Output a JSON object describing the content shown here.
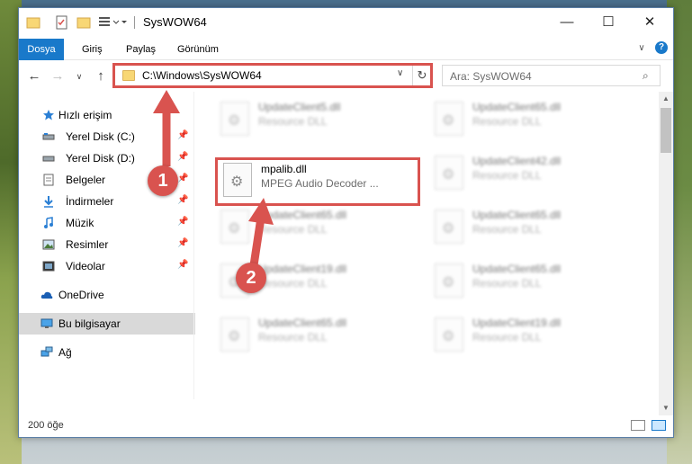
{
  "window": {
    "title": "SysWOW64",
    "min_glyph": "—",
    "max_glyph": "☐",
    "close_glyph": "✕"
  },
  "ribbon": {
    "tabs": [
      "Dosya",
      "Giriş",
      "Paylaş",
      "Görünüm"
    ],
    "expand_glyph": "∨",
    "help_glyph": "?"
  },
  "nav": {
    "back_glyph": "←",
    "forward_glyph": "→",
    "recent_glyph": "∨",
    "up_glyph": "↑",
    "address": "C:\\Windows\\SysWOW64",
    "address_drop_glyph": "∨",
    "refresh_glyph": "↻",
    "search_placeholder": "Ara: SysWOW64",
    "search_glyph": "⌕"
  },
  "sidebar": {
    "quick_access": "Hızlı erişim",
    "items": [
      {
        "label": "Yerel Disk (C:)",
        "icon": "drive-icon"
      },
      {
        "label": "Yerel Disk (D:)",
        "icon": "drive-icon"
      },
      {
        "label": "Belgeler",
        "icon": "documents-icon"
      },
      {
        "label": "İndirmeler",
        "icon": "downloads-icon"
      },
      {
        "label": "Müzik",
        "icon": "music-icon"
      },
      {
        "label": "Resimler",
        "icon": "pictures-icon"
      },
      {
        "label": "Videolar",
        "icon": "videos-icon"
      }
    ],
    "pin_glyph": "📌",
    "onedrive": "OneDrive",
    "this_pc": "Bu bilgisayar",
    "network": "Ağ"
  },
  "files": [
    {
      "name": "UpdateClient5.dll",
      "type": "Resource DLL",
      "blurred": true
    },
    {
      "name": "UpdateClient65.dll",
      "type": "Resource DLL",
      "blurred": true
    },
    {
      "name": "mpalib.dll",
      "type": "MPEG Audio Decoder ...",
      "blurred": false
    },
    {
      "name": "UpdateClient42.dll",
      "type": "Resource DLL",
      "blurred": true
    },
    {
      "name": "UpdateClient65.dll",
      "type": "Resource DLL",
      "blurred": true
    },
    {
      "name": "UpdateClient65.dll",
      "type": "Resource DLL",
      "blurred": true
    },
    {
      "name": "UpdateClient19.dll",
      "type": "Resource DLL",
      "blurred": true
    },
    {
      "name": "UpdateClient65.dll",
      "type": "Resource DLL",
      "blurred": true
    },
    {
      "name": "UpdateClient65.dll",
      "type": "Resource DLL",
      "blurred": true
    },
    {
      "name": "UpdateClient19.dll",
      "type": "Resource DLL",
      "blurred": true
    }
  ],
  "status": {
    "count": "200 öğe"
  },
  "callouts": [
    "1",
    "2"
  ],
  "colors": {
    "accent": "#1979ca",
    "highlight": "#d9534f",
    "selected": "#cce8ff"
  }
}
